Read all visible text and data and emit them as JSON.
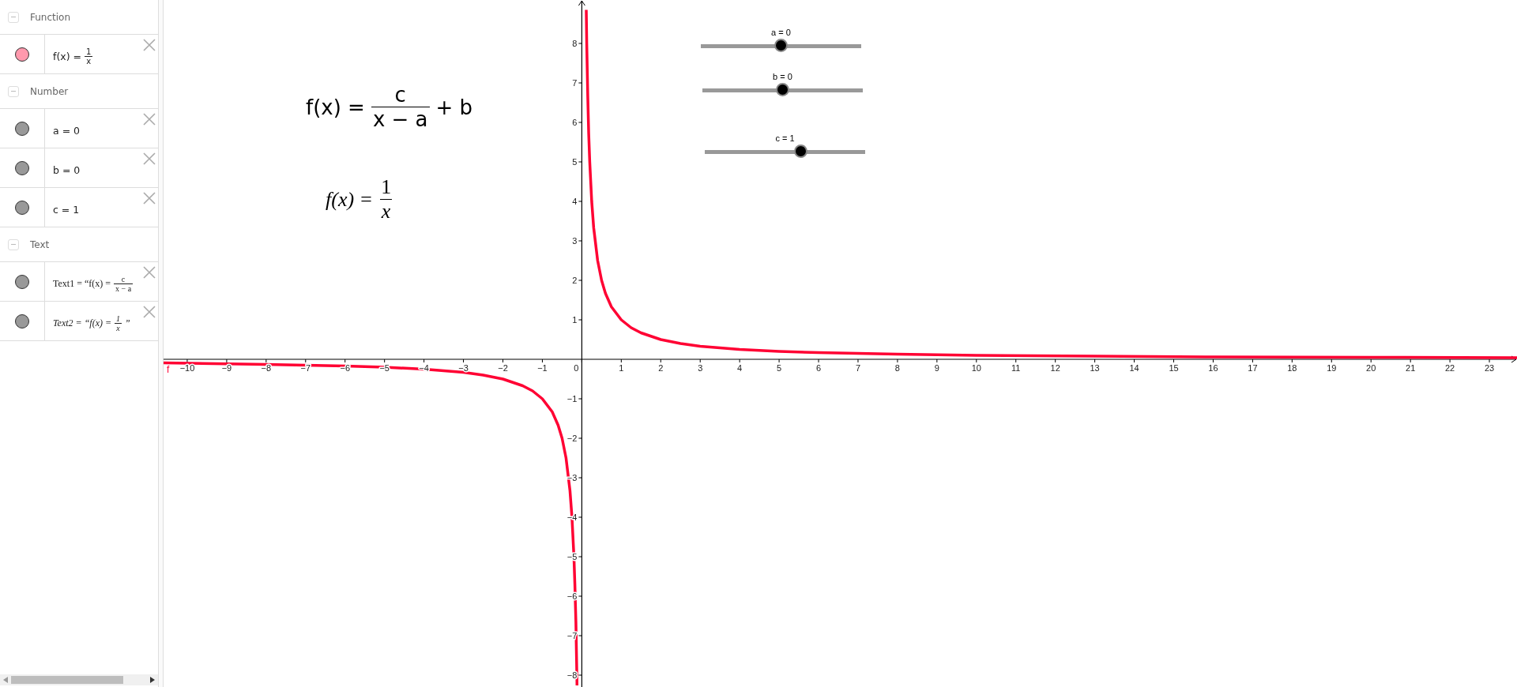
{
  "sections": [
    {
      "title": "Function",
      "items": [
        {
          "kind": "fraction",
          "color": "#ff99ad",
          "prefix": "f(x) =",
          "numerator": "1",
          "denominator": "x"
        }
      ]
    },
    {
      "title": "Number",
      "items": [
        {
          "kind": "plain",
          "color": "#999999",
          "text": "a = 0"
        },
        {
          "kind": "plain",
          "color": "#999999",
          "text": "b = 0"
        },
        {
          "kind": "plain",
          "color": "#999999",
          "text": "c = 1"
        }
      ]
    },
    {
      "title": "Text",
      "items": [
        {
          "kind": "fraction",
          "color": "#999999",
          "prefix": "Text1 = “f(x) =",
          "numerator": "c",
          "denominator": "x − a"
        },
        {
          "kind": "math_fraction",
          "color": "#999999",
          "prefix": "Text2 = “f(x) =",
          "numerator": "1",
          "denominator": "x",
          "suffix": "”"
        }
      ]
    }
  ],
  "formulas": [
    {
      "kind": "sans",
      "prefix": "f(x) =",
      "numerator": "c",
      "denominator": "x − a",
      "suffix": "+ b"
    },
    {
      "kind": "math",
      "prefix": "f(x) =",
      "numerator": "1",
      "denominator": "x"
    }
  ],
  "sliders": [
    {
      "label": "a = 0",
      "level": 0.5
    },
    {
      "label": "b = 0",
      "level": 0.5
    },
    {
      "label": "c = 1",
      "level": 0.6
    }
  ],
  "graphics": {
    "chart_data": {
      "type": "line",
      "xlim": [
        -10.6,
        23.7
      ],
      "ylim": [
        -8.3,
        9.1
      ],
      "x": [
        -10.6,
        -8,
        -6,
        -5,
        -4,
        -3,
        -2.5,
        -2,
        -1.5,
        -1.25,
        -1,
        -0.75,
        -0.6,
        -0.5,
        -0.4,
        -0.3,
        -0.25,
        -0.2,
        -0.175,
        -0.15,
        -0.125,
        -0.121,
        0.113,
        0.125,
        0.15,
        0.175,
        0.2,
        0.25,
        0.3,
        0.4,
        0.5,
        0.6,
        0.75,
        1,
        1.25,
        1.5,
        2,
        2.5,
        3,
        4,
        5,
        6,
        8,
        10,
        13,
        16,
        20,
        23.7
      ],
      "series": [
        {
          "name": "f",
          "color": "#ff0033",
          "values": [
            -0.09,
            -0.13,
            -0.17,
            -0.2,
            -0.25,
            -0.33,
            -0.4,
            -0.5,
            -0.67,
            -0.8,
            -1,
            -1.33,
            -1.67,
            -2,
            -2.5,
            -3.33,
            -4,
            -5,
            -5.71,
            -6.67,
            -8,
            -8.26,
            8.85,
            8,
            6.67,
            5.71,
            5,
            4,
            3.33,
            2.5,
            2,
            1.67,
            1.33,
            1,
            0.8,
            0.67,
            0.5,
            0.4,
            0.33,
            0.25,
            0.2,
            0.17,
            0.13,
            0.1,
            0.08,
            0.06,
            0.05,
            0.04
          ]
        }
      ],
      "xticks": [
        {
          "value": -10,
          "label": "−10"
        },
        {
          "value": -9,
          "label": "−9"
        },
        {
          "value": -8,
          "label": "−8"
        },
        {
          "value": -7,
          "label": "−7"
        },
        {
          "value": -6,
          "label": "−6"
        },
        {
          "value": -5,
          "label": "−5"
        },
        {
          "value": -4,
          "label": "−4"
        },
        {
          "value": -3,
          "label": "−3"
        },
        {
          "value": -2,
          "label": "−2"
        },
        {
          "value": -1,
          "label": "−1"
        },
        0,
        1,
        2,
        3,
        4,
        5,
        6,
        7,
        8,
        9,
        10,
        11,
        12,
        13,
        14,
        15,
        16,
        17,
        18,
        19,
        20,
        21,
        22,
        23
      ],
      "yticks": [
        {
          "value": -8,
          "label": "−8"
        },
        {
          "value": -7,
          "label": "−7"
        },
        {
          "value": -6,
          "label": "−6"
        },
        {
          "value": -5,
          "label": "−5"
        },
        {
          "value": -4,
          "label": "−4"
        },
        {
          "value": -3,
          "label": "−3"
        },
        {
          "value": -2,
          "label": "−2"
        },
        {
          "value": -1,
          "label": "−1"
        },
        1,
        2,
        3,
        4,
        5,
        6,
        7,
        8
      ]
    }
  }
}
